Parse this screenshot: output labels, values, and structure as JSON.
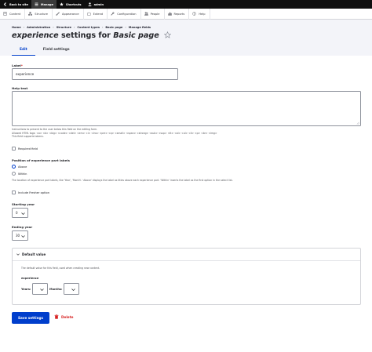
{
  "toolbar": {
    "back_label": "Back to site",
    "manage_label": "Manage",
    "shortcuts_label": "Shortcuts",
    "user_label": "admin"
  },
  "tray": {
    "items": [
      "Content",
      "Structure",
      "Appearance",
      "Extend",
      "Configuration",
      "People",
      "Reports",
      "Help"
    ]
  },
  "breadcrumb": {
    "items": [
      "Home",
      "Administration",
      "Structure",
      "Content types",
      "Basic page",
      "Manage fields"
    ]
  },
  "page": {
    "title_field": "experience",
    "title_middle": " settings for ",
    "title_type": "Basic page"
  },
  "tabs": {
    "edit": "Edit",
    "field_settings": "Field settings"
  },
  "form": {
    "label_label": "Label",
    "label_required_mark": "*",
    "label_value": "experience",
    "help_label": "Help text",
    "help_desc_1": "Instructions to present to the user below this field on the editing form.",
    "help_desc_2": "Allowed HTML tags: <a> <b> <big> <code> <del> <em> <i> <ins> <pre> <q> <small> <span> <strong> <sub> <sup> <tt> <ol> <ul> <li> <p> <br> <img>",
    "help_desc_3": "This field supports tokens.",
    "required_label": "Required field",
    "position_label": "Position of experience part labels",
    "position_above": "Above",
    "position_within": "Within",
    "position_desc": "The location of experience part labels, like 'Year', 'Month'. 'Above' displays the label as titles above each experience part. 'Within' inserts the label as the first option in the select list.",
    "fresher_label": "Include Fresher option",
    "starting_year_label": "Starting year",
    "starting_year_value": "0",
    "ending_year_label": "Ending year",
    "ending_year_value": "30"
  },
  "default_value": {
    "summary": "Default value",
    "desc": "The default value for this field, used when creating new content.",
    "field_label": "experience",
    "years_label": "Years:",
    "months_label": "Months:"
  },
  "actions": {
    "save": "Save settings",
    "delete": "Delete"
  },
  "colors": {
    "primary": "#003ecc",
    "danger": "#d72222",
    "toolbar_bg": "#0f0f0f",
    "header_bg": "#f3f4f9"
  }
}
